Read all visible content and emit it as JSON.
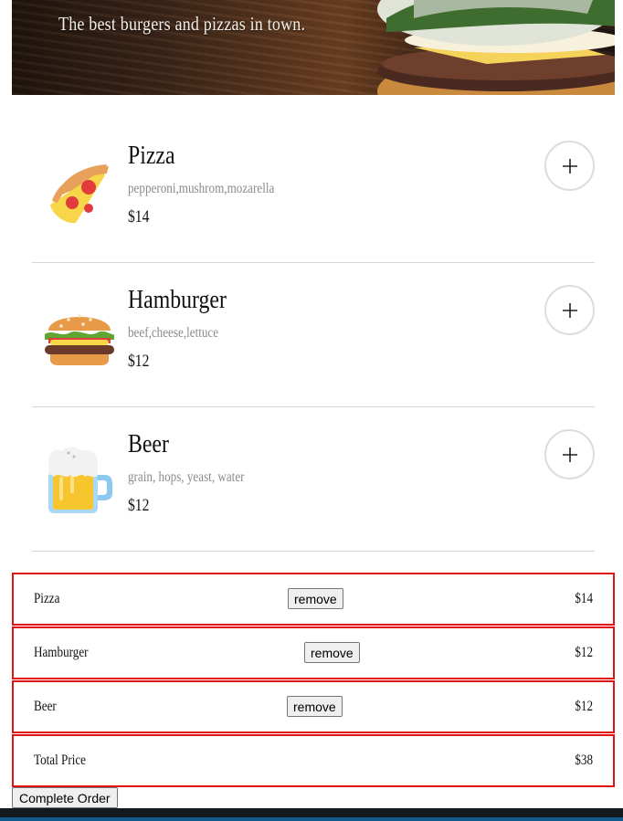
{
  "hero": {
    "subtitle": "The best burgers and pizzas in town."
  },
  "menu": {
    "items": [
      {
        "name": "Pizza",
        "description": "pepperoni,mushrom,mozarella",
        "price": "$14",
        "icon": "pizza-icon",
        "add_icon": "plus-icon"
      },
      {
        "name": "Hamburger",
        "description": "beef,cheese,lettuce",
        "price": "$12",
        "icon": "hamburger-icon",
        "add_icon": "plus-icon"
      },
      {
        "name": "Beer",
        "description": "grain, hops, yeast, water",
        "price": "$12",
        "icon": "beer-mug-icon",
        "add_icon": "plus-icon"
      }
    ]
  },
  "cart": {
    "items": [
      {
        "name": "Pizza",
        "remove_label": "remove",
        "price": "$14"
      },
      {
        "name": "Hamburger",
        "remove_label": "remove",
        "price": "$12"
      },
      {
        "name": "Beer",
        "remove_label": "remove",
        "price": "$12"
      }
    ],
    "total_label": "Total Price",
    "total_value": "$38",
    "complete_label": "Complete Order"
  },
  "colors": {
    "cart_border": "#e11212",
    "divider": "#d6d6d6",
    "description_text": "#8b8b8b",
    "footer": "#14191d",
    "footer_accent": "#0f5c8c"
  }
}
